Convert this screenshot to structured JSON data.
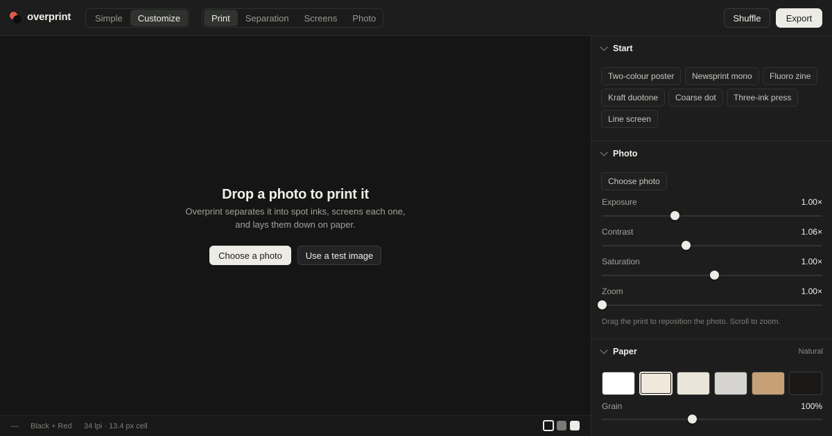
{
  "app": {
    "name": "overprint"
  },
  "mode_tabs": [
    {
      "label": "Simple",
      "active": false
    },
    {
      "label": "Customize",
      "active": true
    }
  ],
  "view_tabs": [
    {
      "label": "Print",
      "active": true
    },
    {
      "label": "Separation",
      "active": false
    },
    {
      "label": "Screens",
      "active": false
    },
    {
      "label": "Photo",
      "active": false
    }
  ],
  "toolbar": {
    "shuffle_label": "Shuffle",
    "export_label": "Export"
  },
  "canvas": {
    "title": "Drop a photo to print it",
    "description_line1": "Overprint separates it into spot inks, screens each one,",
    "description_line2": "and lays them down on paper.",
    "choose_label": "Choose a photo",
    "test_label": "Use a test image"
  },
  "status": {
    "dash": "—",
    "inks": "Black + Red",
    "screen": "34 lpi · 13.4 px cell",
    "background_options": [
      "dark",
      "grey",
      "light"
    ],
    "selected_background": "dark"
  },
  "sidebar": {
    "start": {
      "title": "Start",
      "presets": [
        "Two-colour poster",
        "Newsprint mono",
        "Fluoro zine",
        "Kraft duotone",
        "Coarse dot",
        "Three-ink press",
        "Line screen"
      ]
    },
    "photo": {
      "title": "Photo",
      "choose_label": "Choose photo",
      "sliders": [
        {
          "label": "Exposure",
          "value": "1.00×",
          "fraction": 0.33
        },
        {
          "label": "Contrast",
          "value": "1.06×",
          "fraction": 0.38
        },
        {
          "label": "Saturation",
          "value": "1.00×",
          "fraction": 0.51
        },
        {
          "label": "Zoom",
          "value": "1.00×",
          "fraction": 0.0
        }
      ],
      "hint": "Drag the print to reposition the photo. Scroll to zoom."
    },
    "paper": {
      "title": "Paper",
      "note": "Natural",
      "swatches": [
        "#ffffff",
        "#f1e8dc",
        "#e9e5d9",
        "#d6d4d0",
        "#c6a077",
        "#1a1918"
      ],
      "selected_index": 1,
      "grain": {
        "label": "Grain",
        "value": "100%",
        "fraction": 0.41
      }
    }
  }
}
